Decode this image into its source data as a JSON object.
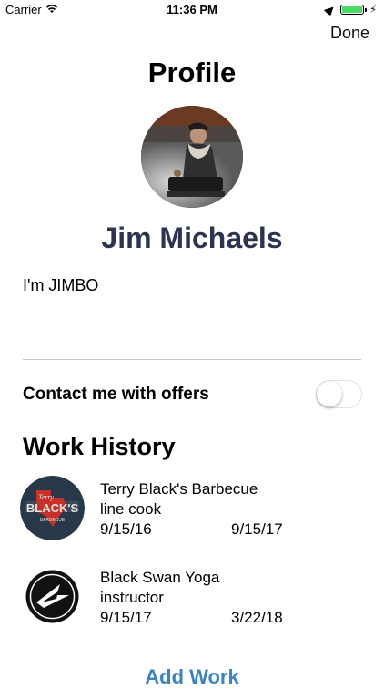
{
  "status_bar": {
    "carrier": "Carrier",
    "time": "11:36 PM",
    "battery_level": 1.0,
    "battery_color": "#4cd964",
    "icons": [
      "wifi-icon",
      "location-arrow-icon",
      "battery-icon",
      "charging-bolt-icon"
    ]
  },
  "nav": {
    "done_label": "Done"
  },
  "profile": {
    "title": "Profile",
    "name": "Jim Michaels",
    "name_color": "#2c3451",
    "bio": "I'm JIMBO"
  },
  "offers": {
    "label": "Contact me with offers",
    "enabled": false
  },
  "work_history": {
    "title": "Work History",
    "items": [
      {
        "company": "Terry Black's Barbecue",
        "role": "line cook",
        "start": "9/15/16",
        "end": "9/15/17",
        "logo": "terry-blacks-logo"
      },
      {
        "company": "Black Swan Yoga",
        "role": "instructor",
        "start": "9/15/17",
        "end": "3/22/18",
        "logo": "black-swan-logo"
      }
    ],
    "add_label": "Add Work",
    "add_color": "#3b84c4"
  }
}
